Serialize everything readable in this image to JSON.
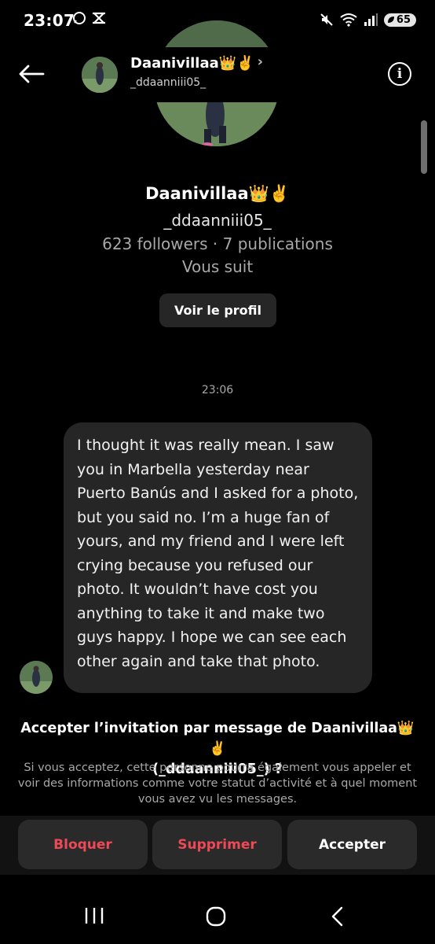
{
  "status_bar": {
    "time": "23:07",
    "battery": "65"
  },
  "header": {
    "name": "Daanivillaa👑✌️",
    "chevron": "›",
    "username": "_ddaanniii05_",
    "info_label": "i"
  },
  "profile": {
    "name": "Daanivillaa👑✌️",
    "username": "_ddaanniii05_",
    "stats": "623 followers · 7 publications",
    "follows_you": "Vous suit",
    "view_profile_label": "Voir le profil"
  },
  "conversation": {
    "timestamp": "23:06",
    "message": "I thought it was really mean. I saw you in Marbella yesterday near Puerto Banús and I asked for a photo, but you said no. I’m a huge fan of yours, and my friend and I were left crying because you refused our photo. It wouldn’t have cost you anything to take it and make two guys happy. I hope we can see each other again and take that photo."
  },
  "invitation": {
    "title_line1": "Accepter l’invitation par message de Daanivillaa👑✌️",
    "title_line2": "(_ddaanniii05_) ?",
    "description": "Si vous acceptez, cette personne pourra également vous appeler et voir des informations comme votre statut d’activité et à quel moment vous avez vu les messages.",
    "block_label": "Bloquer",
    "delete_label": "Supprimer",
    "accept_label": "Accepter"
  },
  "icons": {
    "back": "arrow-left-icon",
    "info": "info-icon",
    "nav_recents": "recents-icon",
    "nav_home": "home-icon",
    "nav_back": "back-icon"
  },
  "colors": {
    "background": "#000000",
    "bubble": "#262626",
    "destructive": "#ed4956",
    "secondary_text": "#a8a8a8"
  }
}
